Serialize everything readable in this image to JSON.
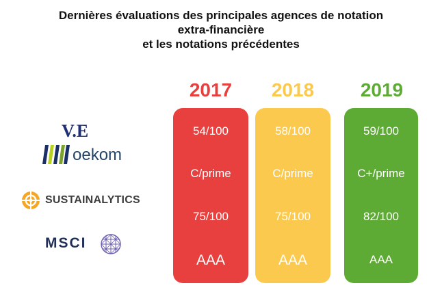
{
  "title": {
    "line1": "Dernières évaluations des principales agences de notation",
    "line2": "extra-financière",
    "line3": "et les notations précédentes"
  },
  "colors": {
    "y2017": "#e8403f",
    "y2018": "#fbc94d",
    "y2019": "#5dab35"
  },
  "agencies": {
    "ve": {
      "text": "V.E",
      "icon": "ve-logo"
    },
    "oekom": {
      "text": "oekom",
      "icon": "oekom-bars-icon"
    },
    "sustainalytics": {
      "text": "SUSTAINALYTICS",
      "icon": "sustainalytics-target-icon"
    },
    "msci": {
      "text": "MSCI",
      "icon": "msci-globe-icon"
    }
  },
  "years": [
    {
      "year": "2017",
      "ve": "54/100",
      "oekom": "C/prime",
      "sustainalytics": "75/100",
      "msci": "AAA"
    },
    {
      "year": "2018",
      "ve": "58/100",
      "oekom": "C/prime",
      "sustainalytics": "75/100",
      "msci": "AAA"
    },
    {
      "year": "2019",
      "ve": "59/100",
      "oekom": "C+/prime",
      "sustainalytics": "82/100",
      "msci": "AAA"
    }
  ]
}
